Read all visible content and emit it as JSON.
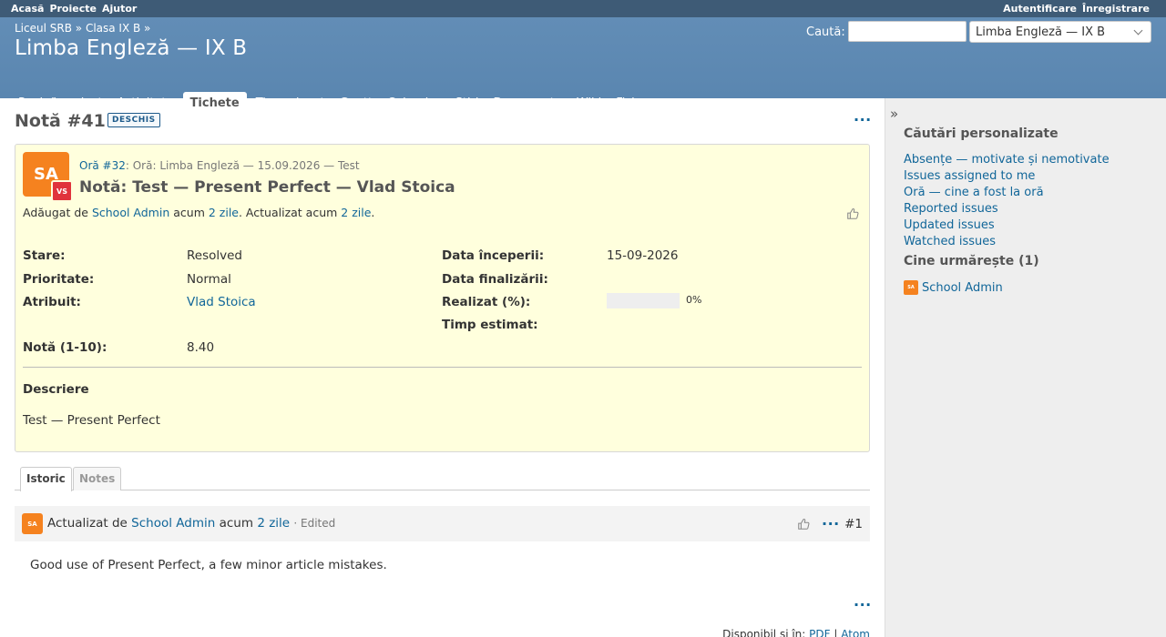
{
  "top_menu": {
    "left": [
      "Acasă",
      "Proiecte",
      "Ajutor"
    ],
    "right": [
      "Autentificare",
      "Înregistrare"
    ]
  },
  "header": {
    "breadcrumb": [
      "Liceul SRB",
      "Clasa IX B"
    ],
    "title": "Limba Engleză — IX B",
    "search_label": "Caută:",
    "search_value": "",
    "project_select": "Limba Engleză — IX B"
  },
  "main_menu": {
    "tabs": [
      "Pagină proiect",
      "Activitate",
      "Tichete",
      "Timp alocat",
      "Gantt",
      "Calendar",
      "Știri",
      "Documente",
      "Wiki",
      "Fișiere"
    ],
    "selected_index": 2
  },
  "issue": {
    "title": "Notă #41",
    "status_badge": "DESCHIS",
    "avatar_initials": "SA",
    "assignee_initials": "VS",
    "parent_link": "Oră #32",
    "parent_rest": ": Oră: Limba Engleză — 15.09.2026 — Test",
    "subject": "Notă: Test — Present Perfect — Vlad Stoica",
    "author_prefix": "Adăugat de",
    "author": "School Admin",
    "added_prefix": "acum",
    "added_ago": "2 zile",
    "updated_prefix": ". Actualizat acum",
    "updated_ago": "2 zile",
    "period": ".",
    "attributes": {
      "status_label": "Stare:",
      "status_value": "Resolved",
      "priority_label": "Prioritate:",
      "priority_value": "Normal",
      "assigned_label": "Atribuit:",
      "assigned_value": "Vlad Stoica",
      "grade_label": "Notă (1-10):",
      "grade_value": "8.40",
      "start_label": "Data începerii:",
      "start_value": "15-09-2026",
      "due_label": "Data finalizării:",
      "due_value": "",
      "done_label": "Realizat (%):",
      "done_value": "0%",
      "done_fraction": 0,
      "estimated_label": "Timp estimat:",
      "estimated_value": ""
    },
    "description_heading": "Descriere",
    "description_text": "Test — Present Perfect"
  },
  "history_tabs": [
    "Istoric",
    "Notes"
  ],
  "journal": {
    "avatar_initials": "SA",
    "prefix": "Actualizat de",
    "author": "School Admin",
    "ago_prefix": "acum",
    "ago": "2 zile",
    "edited": "· Edited",
    "number": "#1",
    "note": "Good use of Present Perfect, a few minor article mistakes."
  },
  "footer": {
    "prefix": "Disponibil și în:",
    "pdf": "PDF",
    "sep": "|",
    "atom": "Atom"
  },
  "sidebar": {
    "queries_heading": "Căutări personalizate",
    "queries": [
      "Absențe — motivate și nemotivate",
      "Issues assigned to me",
      "Oră — cine a fost la oră",
      "Reported issues",
      "Updated issues",
      "Watched issues"
    ],
    "watchers_heading": "Cine urmărește (1)",
    "watcher_initials": "SA",
    "watcher_name": "School Admin"
  },
  "colors": {
    "header": "#628DB6",
    "top_menu": "#3E5B76",
    "issue_background": "#FFFFDD",
    "link": "#116699",
    "avatar_orange": "#F5821F",
    "avatar_red": "#E0333C"
  }
}
